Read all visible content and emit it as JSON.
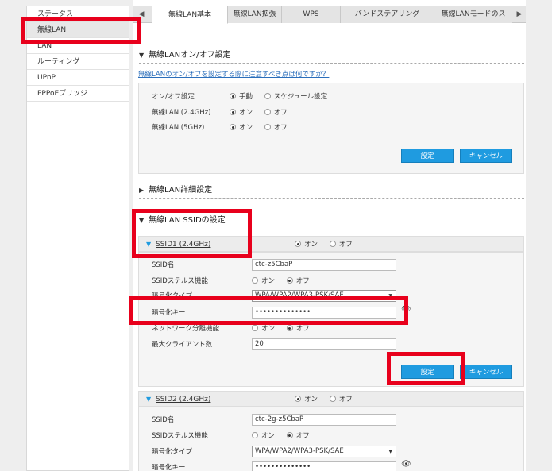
{
  "sidebar": {
    "items": [
      {
        "label": "ステータス"
      },
      {
        "label": "無線LAN"
      },
      {
        "label": "LAN"
      },
      {
        "label": "ルーティング"
      },
      {
        "label": "UPnP"
      },
      {
        "label": "PPPoEブリッジ"
      }
    ],
    "active_index": 1
  },
  "tabs": {
    "left_arrow": "◀",
    "right_arrow": "▶",
    "items": [
      {
        "label": "無線LAN基本"
      },
      {
        "label": "無線LAN拡張"
      },
      {
        "label": "WPS"
      },
      {
        "label": "バンドステアリング"
      },
      {
        "label": "無線LANモードのス"
      }
    ]
  },
  "onoff_section": {
    "title": "無線LANオン/オフ設定",
    "link": "無線LANのオン/オフを設定する際に注意すべき点は何ですか？",
    "rows": [
      {
        "label": "オン/オフ設定",
        "options": [
          "手動",
          "スケジュール設定"
        ],
        "selected": 0
      },
      {
        "label": "無線LAN (2.4GHz)",
        "options": [
          "オン",
          "オフ"
        ],
        "selected": 0
      },
      {
        "label": "無線LAN (5GHz)",
        "options": [
          "オン",
          "オフ"
        ],
        "selected": 0
      }
    ],
    "apply_label": "設定",
    "cancel_label": "キャンセル"
  },
  "detail_section": {
    "title": "無線LAN詳細設定"
  },
  "ssid_section": {
    "title": "無線LAN SSIDの設定",
    "ssid1": {
      "name": "SSID1 (2.4GHz)",
      "toggle_options": [
        "オン",
        "オフ"
      ],
      "toggle_selected": 0,
      "labels": {
        "ssid": "SSID名",
        "stealth": "SSIDステルス機能",
        "encryption": "暗号化タイプ",
        "key": "暗号化キー",
        "separator": "ネットワーク分離機能",
        "max_clients": "最大クライアント数"
      },
      "ssid_value": "ctc-z5CbaP",
      "stealth_options": [
        "オン",
        "オフ"
      ],
      "stealth_selected": 1,
      "encryption_value": "WPA/WPA2/WPA3-PSK/SAE",
      "key_value": "••••••••••••••",
      "separator_options": [
        "オン",
        "オフ"
      ],
      "separator_selected": 1,
      "max_clients_value": "20",
      "apply_label": "設定",
      "cancel_label": "キャンセル"
    },
    "ssid2": {
      "name": "SSID2 (2.4GHz)",
      "toggle_options": [
        "オン",
        "オフ"
      ],
      "toggle_selected": 0,
      "labels": {
        "ssid": "SSID名",
        "stealth": "SSIDステルス機能",
        "encryption": "暗号化タイプ",
        "key": "暗号化キー"
      },
      "ssid_value": "ctc-2g-z5CbaP",
      "stealth_options": [
        "オン",
        "オフ"
      ],
      "stealth_selected": 1,
      "encryption_value": "WPA/WPA2/WPA3-PSK/SAE",
      "key_value": "••••••••••••••"
    }
  },
  "colors": {
    "accent": "#1f9be0",
    "highlight": "#e8001c",
    "link": "#2a6ebb"
  }
}
